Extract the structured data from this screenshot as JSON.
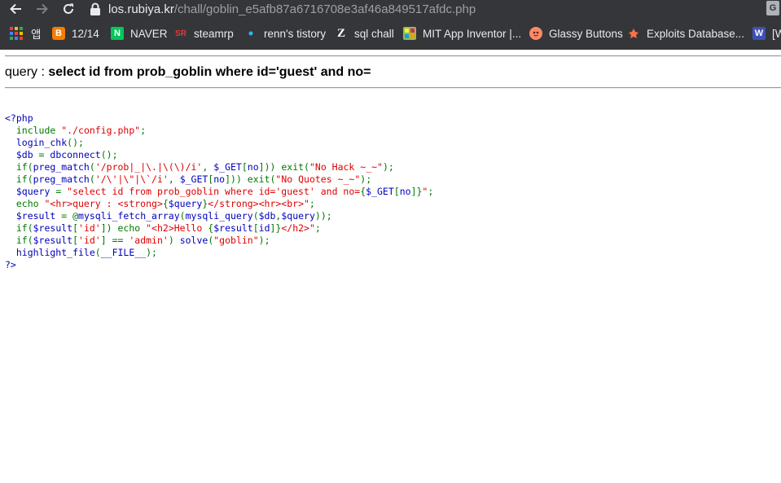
{
  "browser": {
    "url_host": "los.rubiya.kr",
    "url_path": "/chall/goblin_e5afb87a6716708e3af46a849517afdc.php",
    "bookmarks": [
      {
        "label": "앱",
        "icon": "apps-grid-icon"
      },
      {
        "label": "12/14",
        "icon": "blogger-icon",
        "color": "#f57d00"
      },
      {
        "label": "NAVER",
        "icon": "naver-icon",
        "color": "#03c75a"
      },
      {
        "label": "steamrp",
        "icon": "steamrp-icon"
      },
      {
        "label": "renn's tistory",
        "icon": "tistory-icon"
      },
      {
        "label": "sql chall",
        "icon": "z-icon"
      },
      {
        "label": "MIT App Inventor |...",
        "icon": "app-inventor-icon"
      },
      {
        "label": "Glassy Buttons",
        "icon": "glassy-buttons-icon"
      },
      {
        "label": "Exploits Database...",
        "icon": "exploit-db-icon"
      }
    ],
    "bookmark_overflow_label": "[W"
  },
  "page": {
    "query_label": "query : ",
    "query_value": "select id from prob_goblin where id='guest' and no="
  },
  "code_lines": [
    [
      [
        "def",
        "<?php"
      ]
    ],
    [
      [
        "def",
        "  "
      ],
      [
        "kw",
        "include "
      ],
      [
        "str",
        "\"./config.php\""
      ],
      [
        "kw",
        ";"
      ]
    ],
    [
      [
        "def",
        "  login_chk"
      ],
      [
        "kw",
        "();"
      ]
    ],
    [
      [
        "def",
        "  $db "
      ],
      [
        "kw",
        "= "
      ],
      [
        "def",
        "dbconnect"
      ],
      [
        "kw",
        "();"
      ]
    ],
    [
      [
        "kw",
        "  if("
      ],
      [
        "def",
        "preg_match"
      ],
      [
        "kw",
        "("
      ],
      [
        "str",
        "'/prob|_|\\.|\\(\\)/i'"
      ],
      [
        "kw",
        ", "
      ],
      [
        "def",
        "$_GET"
      ],
      [
        "kw",
        "["
      ],
      [
        "def",
        "no"
      ],
      [
        "kw",
        "])) exit("
      ],
      [
        "str",
        "\"No Hack ~_~\""
      ],
      [
        "kw",
        ");"
      ]
    ],
    [
      [
        "kw",
        "  if("
      ],
      [
        "def",
        "preg_match"
      ],
      [
        "kw",
        "("
      ],
      [
        "str",
        "'/\\'|\\\"|\\`/i'"
      ],
      [
        "kw",
        ", "
      ],
      [
        "def",
        "$_GET"
      ],
      [
        "kw",
        "["
      ],
      [
        "def",
        "no"
      ],
      [
        "kw",
        "])) exit("
      ],
      [
        "str",
        "\"No Quotes ~_~\""
      ],
      [
        "kw",
        ");"
      ]
    ],
    [
      [
        "def",
        "  $query "
      ],
      [
        "kw",
        "= "
      ],
      [
        "str",
        "\"select id from prob_goblin where id='guest' and no="
      ],
      [
        "kw",
        "{"
      ],
      [
        "def",
        "$_GET"
      ],
      [
        "kw",
        "["
      ],
      [
        "def",
        "no"
      ],
      [
        "kw",
        "]}"
      ],
      [
        "str",
        "\""
      ],
      [
        "kw",
        ";"
      ]
    ],
    [
      [
        "kw",
        "  echo "
      ],
      [
        "str",
        "\"<hr>query : <strong>"
      ],
      [
        "kw",
        "{"
      ],
      [
        "def",
        "$query"
      ],
      [
        "kw",
        "}"
      ],
      [
        "str",
        "</strong><hr><br>\""
      ],
      [
        "kw",
        ";"
      ]
    ],
    [
      [
        "def",
        "  $result "
      ],
      [
        "kw",
        "= @"
      ],
      [
        "def",
        "mysqli_fetch_array"
      ],
      [
        "kw",
        "("
      ],
      [
        "def",
        "mysqli_query"
      ],
      [
        "kw",
        "("
      ],
      [
        "def",
        "$db"
      ],
      [
        "kw",
        ","
      ],
      [
        "def",
        "$query"
      ],
      [
        "kw",
        "));"
      ]
    ],
    [
      [
        "kw",
        "  if("
      ],
      [
        "def",
        "$result"
      ],
      [
        "kw",
        "["
      ],
      [
        "str",
        "'id'"
      ],
      [
        "kw",
        "]) echo "
      ],
      [
        "str",
        "\"<h2>Hello "
      ],
      [
        "kw",
        "{"
      ],
      [
        "def",
        "$result"
      ],
      [
        "kw",
        "["
      ],
      [
        "def",
        "id"
      ],
      [
        "kw",
        "]}"
      ],
      [
        "str",
        "</h2>\""
      ],
      [
        "kw",
        ";"
      ]
    ],
    [
      [
        "kw",
        "  if("
      ],
      [
        "def",
        "$result"
      ],
      [
        "kw",
        "["
      ],
      [
        "str",
        "'id'"
      ],
      [
        "kw",
        "] == "
      ],
      [
        "str",
        "'admin'"
      ],
      [
        "kw",
        ") "
      ],
      [
        "def",
        "solve"
      ],
      [
        "kw",
        "("
      ],
      [
        "str",
        "\"goblin\""
      ],
      [
        "kw",
        ");"
      ]
    ],
    [
      [
        "def",
        "  highlight_file"
      ],
      [
        "kw",
        "("
      ],
      [
        "def",
        "__FILE__"
      ],
      [
        "kw",
        ");"
      ]
    ],
    [
      [
        "def",
        "?>"
      ]
    ]
  ],
  "colors": {
    "chrome_bg": "#35363a",
    "php_default": "#0000BB",
    "php_keyword": "#007700",
    "php_string": "#DD0000"
  }
}
